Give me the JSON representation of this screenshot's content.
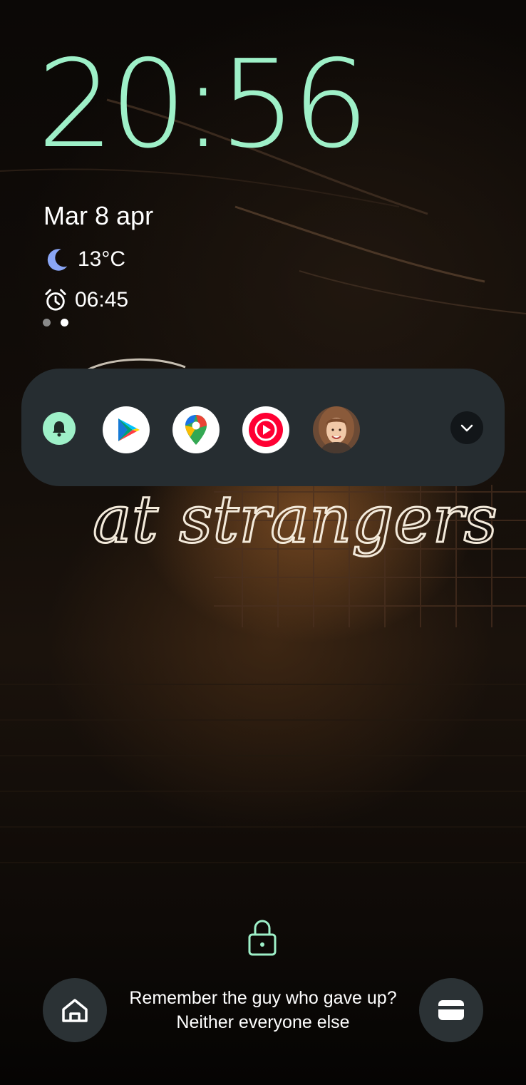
{
  "clock": {
    "time": "20:56"
  },
  "date": "Mar 8 apr",
  "weather": {
    "icon": "moon-icon",
    "temperature": "13°C"
  },
  "alarm": {
    "icon": "alarm-clock-icon",
    "time": "06:45"
  },
  "pager": {
    "pages": 2,
    "active": 2
  },
  "wallpaper": {
    "neon_text": "at strangers"
  },
  "notification_shelf": {
    "icons": [
      {
        "name": "bell-icon"
      },
      {
        "name": "google-play-icon"
      },
      {
        "name": "google-maps-icon"
      },
      {
        "name": "youtube-music-icon"
      },
      {
        "name": "contact-avatar"
      }
    ],
    "expand_icon": "chevron-down-icon"
  },
  "lock": {
    "icon": "lock-icon"
  },
  "shortcuts": {
    "left_icon": "home-icon",
    "right_icon": "wallet-icon"
  },
  "owner_message": "Remember the guy who gave up? Neither everyone else",
  "colors": {
    "clock": "#9ef0c8",
    "shelf": "#262d31",
    "accent": "#9ef0c8"
  }
}
